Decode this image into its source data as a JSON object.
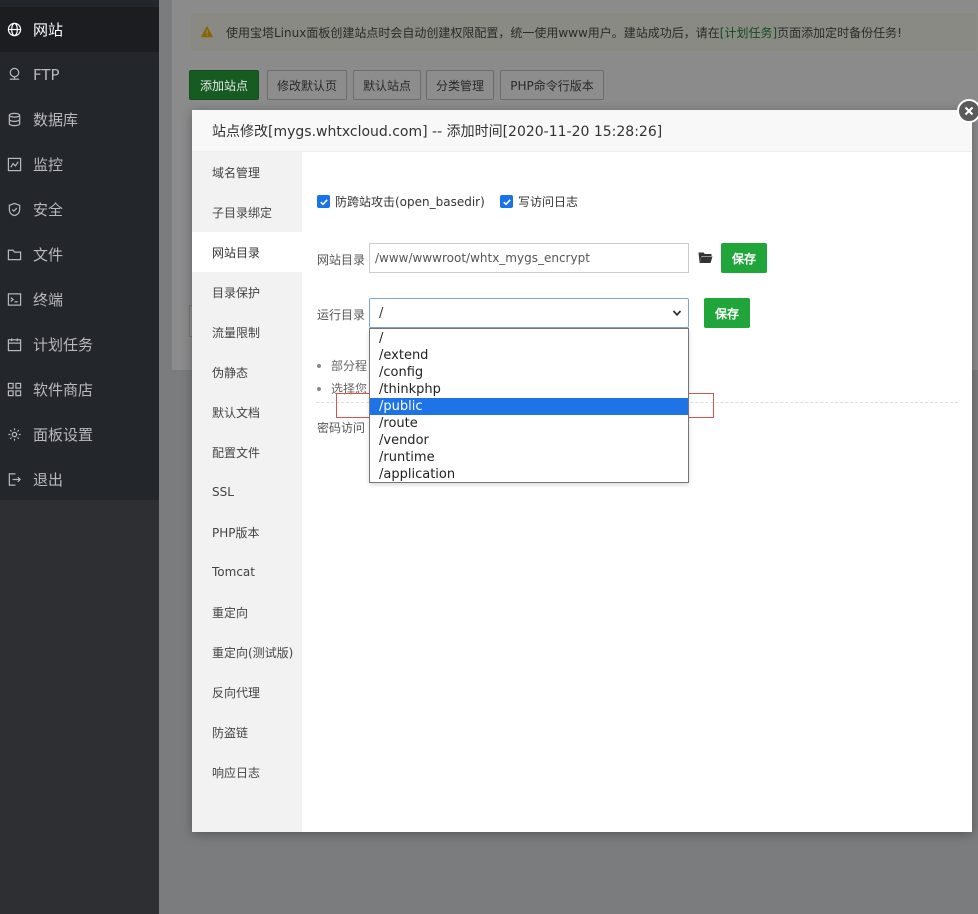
{
  "sidebar": {
    "items": [
      {
        "label": "网站",
        "icon": "globe-icon",
        "active": true
      },
      {
        "label": "FTP",
        "icon": "ftp-icon",
        "active": false
      },
      {
        "label": "数据库",
        "icon": "database-icon",
        "active": false
      },
      {
        "label": "监控",
        "icon": "monitor-icon",
        "active": false
      },
      {
        "label": "安全",
        "icon": "shield-icon",
        "active": false
      },
      {
        "label": "文件",
        "icon": "folder-icon",
        "active": false
      },
      {
        "label": "终端",
        "icon": "terminal-icon",
        "active": false
      },
      {
        "label": "计划任务",
        "icon": "calendar-icon",
        "active": false
      },
      {
        "label": "软件商店",
        "icon": "apps-icon",
        "active": false
      },
      {
        "label": "面板设置",
        "icon": "gear-icon",
        "active": false
      },
      {
        "label": "退出",
        "icon": "logout-icon",
        "active": false
      }
    ]
  },
  "notice": {
    "text_before": "使用宝塔Linux面板创建站点时会自动创建权限配置，统一使用www用户。建站成功后，请在",
    "link": "[计划任务]",
    "text_after": "页面添加定时备份任务!"
  },
  "toolbar": {
    "add_site": "添加站点",
    "edit_default_page": "修改默认页",
    "default_site": "默认站点",
    "category_manage": "分类管理",
    "php_cli_version": "PHP命令行版本"
  },
  "modal": {
    "title": "站点修改[mygs.whtxcloud.com] -- 添加时间[2020-11-20 15:28:26]",
    "nav": [
      "域名管理",
      "子目录绑定",
      "网站目录",
      "目录保护",
      "流量限制",
      "伪静态",
      "默认文档",
      "配置文件",
      "SSL",
      "PHP版本",
      "Tomcat",
      "重定向",
      "重定向(测试版)",
      "反向代理",
      "防盗链",
      "响应日志"
    ],
    "active_nav_index": 2,
    "checkbox_anti_xss": "防跨站攻击(open_basedir)",
    "checkbox_access_log": "写访问日志",
    "site_dir_label": "网站目录",
    "site_dir_value": "/www/wwwroot/whtx_mygs_encrypt",
    "save_label": "保存",
    "run_dir_label": "运行目录",
    "run_dir_value": "/",
    "bullet_1": "部分程",
    "bullet_2": "选择您",
    "password_access_label": "密码访问",
    "dropdown_options": [
      "/",
      "/extend",
      "/config",
      "/thinkphp",
      "/public",
      "/route",
      "/vendor",
      "/runtime",
      "/application"
    ],
    "selected_option_index": 4
  },
  "colors": {
    "accent_green": "#20a53a",
    "selected_blue": "#1e74e6",
    "sidebar_bg": "#23262b",
    "highlight_red": "#d9534f"
  }
}
